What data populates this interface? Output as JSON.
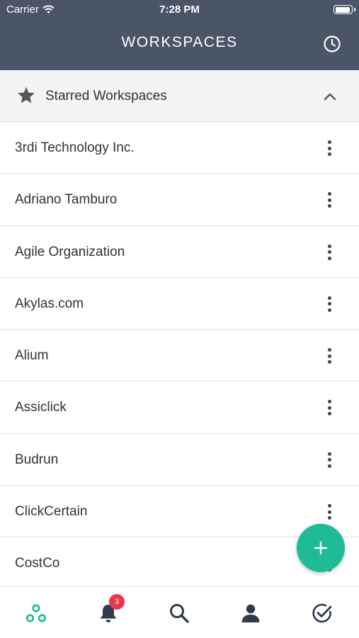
{
  "status_bar": {
    "carrier": "Carrier",
    "time": "7:28 PM"
  },
  "header": {
    "title": "WORKSPACES",
    "icon": "history-clock-icon"
  },
  "starred": {
    "label": "Starred Workspaces",
    "icon": "star-icon"
  },
  "workspaces": [
    "3rdi Technology Inc.",
    "Adriano Tamburo",
    "Agile Organization",
    "Akylas.com",
    "Alium",
    "Assiclick",
    "Budrun",
    "ClickCertain",
    "CostCo"
  ],
  "fab": {
    "icon": "plus-icon"
  },
  "tabbar": {
    "tabs": [
      "workspaces-icon",
      "bell-icon",
      "search-icon",
      "profile-icon",
      "tasks-check-icon"
    ],
    "notification_count": "3"
  },
  "colors": {
    "header_bg": "#4a5568",
    "accent": "#1fba97",
    "badge": "#e8374d"
  }
}
